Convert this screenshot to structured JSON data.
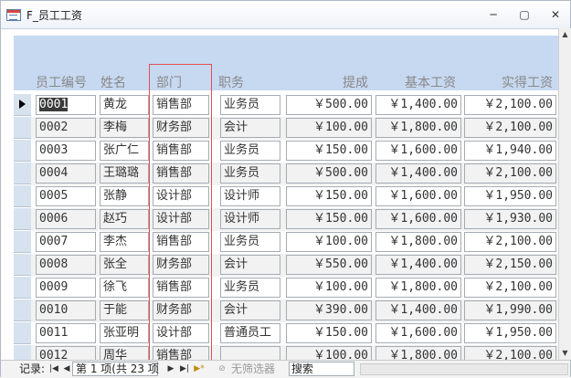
{
  "window": {
    "title": "F_员工工资",
    "minimize": "─",
    "maximize": "▢",
    "close": "✕"
  },
  "headers": {
    "id": "员工编号",
    "name": "姓名",
    "dept": "部门",
    "role": "职务",
    "bonus": "提成",
    "base": "基本工资",
    "actual": "实得工资"
  },
  "rows": [
    {
      "id": "0001",
      "name": "黄龙",
      "dept": "销售部",
      "role": "业务员",
      "bonus": "￥500.00",
      "base": "￥1,400.00",
      "actual": "￥2,100.00"
    },
    {
      "id": "0002",
      "name": "李梅",
      "dept": "财务部",
      "role": "会计",
      "bonus": "￥100.00",
      "base": "￥1,800.00",
      "actual": "￥2,100.00"
    },
    {
      "id": "0003",
      "name": "张广仁",
      "dept": "销售部",
      "role": "业务员",
      "bonus": "￥150.00",
      "base": "￥1,600.00",
      "actual": "￥1,940.00"
    },
    {
      "id": "0004",
      "name": "王璐璐",
      "dept": "销售部",
      "role": "业务员",
      "bonus": "￥500.00",
      "base": "￥1,400.00",
      "actual": "￥2,100.00"
    },
    {
      "id": "0005",
      "name": "张静",
      "dept": "设计部",
      "role": "设计师",
      "bonus": "￥150.00",
      "base": "￥1,600.00",
      "actual": "￥1,950.00"
    },
    {
      "id": "0006",
      "name": "赵巧",
      "dept": "设计部",
      "role": "设计师",
      "bonus": "￥150.00",
      "base": "￥1,600.00",
      "actual": "￥1,930.00"
    },
    {
      "id": "0007",
      "name": "李杰",
      "dept": "销售部",
      "role": "业务员",
      "bonus": "￥100.00",
      "base": "￥1,800.00",
      "actual": "￥2,100.00"
    },
    {
      "id": "0008",
      "name": "张全",
      "dept": "财务部",
      "role": "会计",
      "bonus": "￥550.00",
      "base": "￥1,400.00",
      "actual": "￥2,150.00"
    },
    {
      "id": "0009",
      "name": "徐飞",
      "dept": "销售部",
      "role": "业务员",
      "bonus": "￥100.00",
      "base": "￥1,800.00",
      "actual": "￥2,100.00"
    },
    {
      "id": "0010",
      "name": "于能",
      "dept": "财务部",
      "role": "会计",
      "bonus": "￥390.00",
      "base": "￥1,400.00",
      "actual": "￥1,990.00"
    },
    {
      "id": "0011",
      "name": "张亚明",
      "dept": "设计部",
      "role": "普通员工",
      "bonus": "￥150.00",
      "base": "￥1,600.00",
      "actual": "￥1,950.00"
    },
    {
      "id": "0012",
      "name": "周华",
      "dept": "销售部",
      "role": "",
      "bonus": "￥100.00",
      "base": "￥1,800.00",
      "actual": "￥2,100.00"
    }
  ],
  "statusbar": {
    "record_label": "记录:",
    "record_position": "第 1 项(共 23 项",
    "filter": "无筛选器",
    "search": "搜索"
  }
}
